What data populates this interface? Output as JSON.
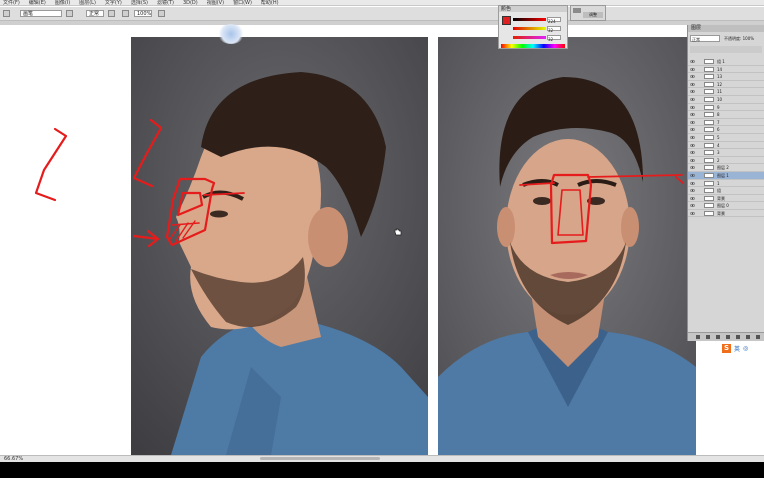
{
  "app": {
    "menu_items": [
      "文件(F)",
      "编辑(E)",
      "图像(I)",
      "图层(L)",
      "文字(Y)",
      "选择(S)",
      "滤镜(T)",
      "3D(D)",
      "视图(V)",
      "窗口(W)",
      "帮助(H)"
    ],
    "watermark": "",
    "ime_label": "英"
  },
  "options_bar": {
    "tool_field": "画笔",
    "mode_field": "正常",
    "opacity_field": "100%",
    "flow_field": "100%"
  },
  "color_panel": {
    "title": "颜色",
    "fg_color": "#e02020",
    "r_value": "224",
    "g_value": "32",
    "b_value": "32",
    "mini_button": "调整"
  },
  "layers_panel": {
    "title": "图层",
    "blend_mode": "正常",
    "opacity_label": "不透明度: 100%",
    "rows": [
      {
        "label": "组 1",
        "selected": false
      },
      {
        "label": "14",
        "selected": false
      },
      {
        "label": "13",
        "selected": false
      },
      {
        "label": "12",
        "selected": false
      },
      {
        "label": "11",
        "selected": false
      },
      {
        "label": "10",
        "selected": false
      },
      {
        "label": "9",
        "selected": false
      },
      {
        "label": "8",
        "selected": false
      },
      {
        "label": "7",
        "selected": false
      },
      {
        "label": "6",
        "selected": false
      },
      {
        "label": "5",
        "selected": false
      },
      {
        "label": "4",
        "selected": false
      },
      {
        "label": "3",
        "selected": false
      },
      {
        "label": "2",
        "selected": false
      },
      {
        "label": "图层 2",
        "selected": false
      },
      {
        "label": "图层 1",
        "selected": true
      },
      {
        "label": "1",
        "selected": false
      },
      {
        "label": "组",
        "selected": false
      },
      {
        "label": "背景",
        "selected": false
      },
      {
        "label": "图层 0",
        "selected": false
      },
      {
        "label": "背景",
        "selected": false
      }
    ]
  },
  "status": {
    "zoom": "66.67%"
  },
  "colors": {
    "accent_red": "#e61b1b",
    "selection_blue": "#9ab4d6"
  }
}
